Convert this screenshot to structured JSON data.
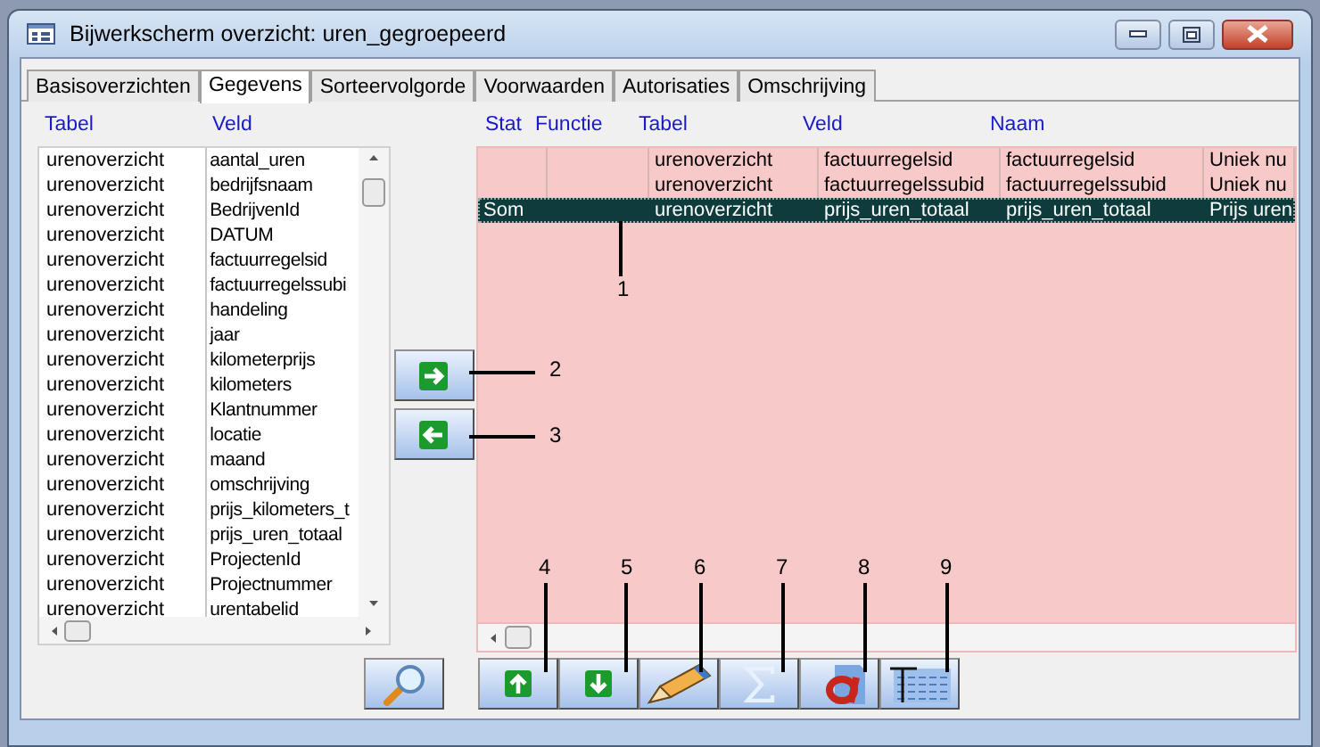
{
  "window": {
    "title": "Bijwerkscherm overzicht: uren_gegroepeerd"
  },
  "tabs": [
    {
      "label": "Basisoverzichten",
      "selected": false
    },
    {
      "label": "Gegevens",
      "selected": true
    },
    {
      "label": "Sorteervolgorde",
      "selected": false
    },
    {
      "label": "Voorwaarden",
      "selected": false
    },
    {
      "label": "Autorisaties",
      "selected": false
    },
    {
      "label": "Omschrijving",
      "selected": false
    }
  ],
  "field_list": {
    "columns": [
      "Tabel",
      "Veld"
    ],
    "rows": [
      {
        "tabel": "urenoverzicht",
        "veld": "aantal_uren"
      },
      {
        "tabel": "urenoverzicht",
        "veld": "bedrijfsnaam"
      },
      {
        "tabel": "urenoverzicht",
        "veld": "BedrijvenId"
      },
      {
        "tabel": "urenoverzicht",
        "veld": "DATUM"
      },
      {
        "tabel": "urenoverzicht",
        "veld": "factuurregelsid"
      },
      {
        "tabel": "urenoverzicht",
        "veld": "factuurregelssubi"
      },
      {
        "tabel": "urenoverzicht",
        "veld": "handeling"
      },
      {
        "tabel": "urenoverzicht",
        "veld": "jaar"
      },
      {
        "tabel": "urenoverzicht",
        "veld": "kilometerprijs"
      },
      {
        "tabel": "urenoverzicht",
        "veld": "kilometers"
      },
      {
        "tabel": "urenoverzicht",
        "veld": "Klantnummer"
      },
      {
        "tabel": "urenoverzicht",
        "veld": "locatie"
      },
      {
        "tabel": "urenoverzicht",
        "veld": "maand"
      },
      {
        "tabel": "urenoverzicht",
        "veld": "omschrijving"
      },
      {
        "tabel": "urenoverzicht",
        "veld": "prijs_kilometers_t"
      },
      {
        "tabel": "urenoverzicht",
        "veld": "prijs_uren_totaal"
      },
      {
        "tabel": "urenoverzicht",
        "veld": "ProjectenId"
      },
      {
        "tabel": "urenoverzicht",
        "veld": "Projectnummer"
      },
      {
        "tabel": "urenoverzicht",
        "veld": "urentabelid"
      }
    ]
  },
  "transfer_buttons": [
    {
      "kind": "add"
    },
    {
      "kind": "remove"
    }
  ],
  "selection_grid": {
    "columns": [
      "Stat",
      "Functie",
      "Tabel",
      "Veld",
      "Naam"
    ],
    "rows": [
      {
        "tabel": "urenoverzicht",
        "veld": "factuurregelsid",
        "naam": "factuurregelsid",
        "column_6": "Uniek nu",
        "selected": false
      },
      {
        "tabel": "urenoverzicht",
        "veld": "factuurregelssubid",
        "naam": "factuurregelssubid",
        "column_6": "Uniek nu",
        "selected": false
      },
      {
        "stat": "Som",
        "tabel": "urenoverzicht",
        "veld": "prijs_uren_totaal",
        "naam": "prijs_uren_totaal",
        "column_6": "Prijs uren",
        "selected": true
      }
    ]
  },
  "toolbar_buttons": [
    {
      "kind": "search"
    },
    {
      "kind": "up"
    },
    {
      "kind": "down"
    },
    {
      "kind": "edit"
    },
    {
      "kind": "sum"
    },
    {
      "kind": "text"
    },
    {
      "kind": "layout"
    }
  ],
  "callouts": [
    {
      "label": "1"
    },
    {
      "label": "2"
    },
    {
      "label": "3"
    },
    {
      "label": "4"
    },
    {
      "label": "5"
    },
    {
      "label": "6"
    },
    {
      "label": "7"
    },
    {
      "label": "8"
    },
    {
      "label": "9"
    }
  ]
}
